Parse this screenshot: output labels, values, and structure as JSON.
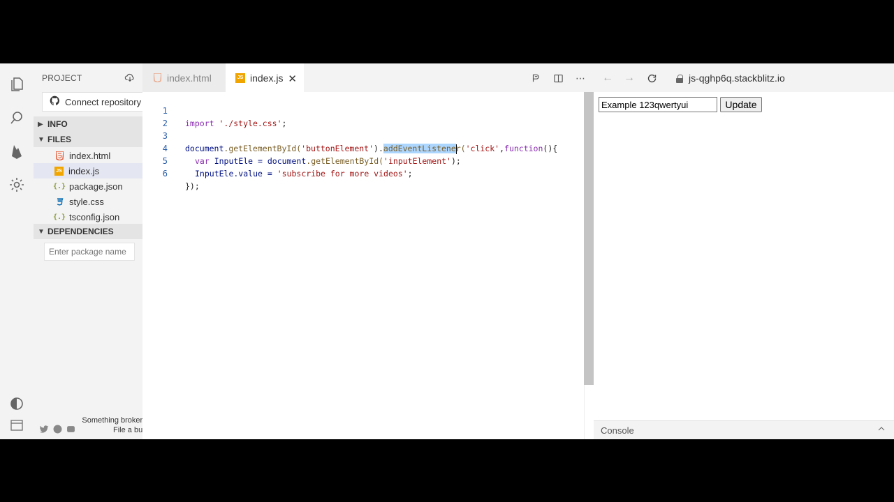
{
  "sidebar": {
    "title": "PROJECT",
    "connect_label": "Connect repository",
    "sections": {
      "info": "INFO",
      "files": "FILES",
      "dependencies": "DEPENDENCIES"
    },
    "files": [
      {
        "name": "index.html",
        "icon": "html5-icon"
      },
      {
        "name": "index.js",
        "icon": "js-icon"
      },
      {
        "name": "package.json",
        "icon": "json-icon"
      },
      {
        "name": "style.css",
        "icon": "css3-icon"
      },
      {
        "name": "tsconfig.json",
        "icon": "json-icon"
      }
    ],
    "package_placeholder": "Enter package name",
    "footer_line1": "Something broker",
    "footer_line2": "File a bu"
  },
  "editor": {
    "tabs": [
      {
        "label": "index.html",
        "active": false
      },
      {
        "label": "index.js",
        "active": true
      }
    ],
    "close_glyph": "✕",
    "line_numbers": [
      "1",
      "2",
      "3",
      "4",
      "5",
      "6"
    ],
    "code": {
      "l1_kw": "import",
      "l1_str": "'./style.css'",
      "l1_end": ";",
      "l3_obj": "document",
      "l3_fn1": ".getElementById(",
      "l3_str1": "'buttonElement'",
      "l3_dot": ").",
      "l3_sel": "addEventListene",
      "l3_after": "r(",
      "l3_str2": "'click'",
      "l3_comma": ",",
      "l3_kw": "function",
      "l3_end": "(){",
      "l4_kw": "var",
      "l4_var": " InputEle = ",
      "l4_obj": "document",
      "l4_fn": ".getElementById(",
      "l4_str": "'inputElement'",
      "l4_end": ");",
      "l5_var": "InputEle.value = ",
      "l5_str": "'subscribe for more videos'",
      "l5_end": ";",
      "l6": "});"
    }
  },
  "preview": {
    "url": "js-qghp6q.stackblitz.io",
    "input_value": "Example 123qwertyui",
    "button_label": "Update",
    "console_label": "Console"
  },
  "colors": {
    "html": "#e44d26",
    "js": "#f0a500",
    "css": "#1572b6",
    "json": "#8a9a3b",
    "keyword": "#8a2db0",
    "string": "#a31515",
    "selection": "#add6ff"
  }
}
